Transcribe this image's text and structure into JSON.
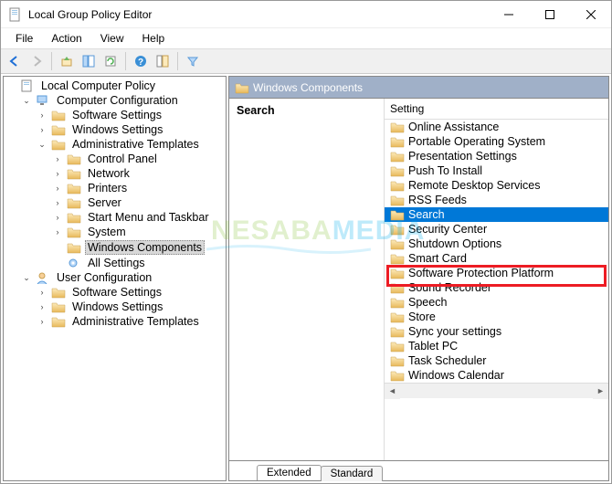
{
  "window": {
    "title": "Local Group Policy Editor"
  },
  "menu": [
    "File",
    "Action",
    "View",
    "Help"
  ],
  "tree": {
    "root": "Local Computer Policy",
    "cc": "Computer Configuration",
    "cc_items": [
      "Software Settings",
      "Windows Settings"
    ],
    "at": "Administrative Templates",
    "at_items": [
      "Control Panel",
      "Network",
      "Printers",
      "Server",
      "Start Menu and Taskbar",
      "System",
      "Windows Components",
      "All Settings"
    ],
    "uc": "User Configuration",
    "uc_items": [
      "Software Settings",
      "Windows Settings",
      "Administrative Templates"
    ]
  },
  "right": {
    "header": "Windows Components",
    "heading": "Search",
    "col_header": "Setting",
    "items": [
      "Online Assistance",
      "Portable Operating System",
      "Presentation Settings",
      "Push To Install",
      "Remote Desktop Services",
      "RSS Feeds",
      "Search",
      "Security Center",
      "Shutdown Options",
      "Smart Card",
      "Software Protection Platform",
      "Sound Recorder",
      "Speech",
      "Store",
      "Sync your settings",
      "Tablet PC",
      "Task Scheduler",
      "Windows Calendar"
    ],
    "selected_index": 6,
    "tabs": [
      "Extended",
      "Standard"
    ]
  },
  "watermark": {
    "part1": "NESABA",
    "part2": "MEDIA"
  }
}
